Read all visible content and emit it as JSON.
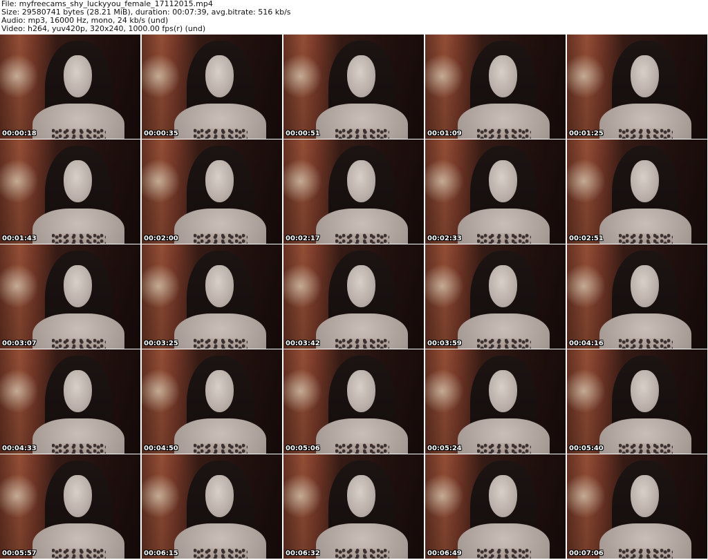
{
  "header": {
    "file": "File: myfreecams_shy_luckyyou_female_17112015.mp4",
    "size": "Size: 29580741 bytes (28.21 MiB), duration: 00:07:39, avg.bitrate: 516 kb/s",
    "audio": "Audio: mp3, 16000 Hz, mono, 24 kb/s (und)",
    "video": "Video: h264, yuv420p, 320x240, 1000.00 fps(r) (und)"
  },
  "thumbnails": [
    {
      "timestamp": "00:00:18"
    },
    {
      "timestamp": "00:00:35"
    },
    {
      "timestamp": "00:00:51"
    },
    {
      "timestamp": "00:01:09"
    },
    {
      "timestamp": "00:01:25"
    },
    {
      "timestamp": "00:01:43"
    },
    {
      "timestamp": "00:02:00"
    },
    {
      "timestamp": "00:02:17"
    },
    {
      "timestamp": "00:02:33"
    },
    {
      "timestamp": "00:02:51"
    },
    {
      "timestamp": "00:03:07"
    },
    {
      "timestamp": "00:03:25"
    },
    {
      "timestamp": "00:03:42"
    },
    {
      "timestamp": "00:03:59"
    },
    {
      "timestamp": "00:04:16"
    },
    {
      "timestamp": "00:04:33"
    },
    {
      "timestamp": "00:04:50"
    },
    {
      "timestamp": "00:05:06"
    },
    {
      "timestamp": "00:05:24"
    },
    {
      "timestamp": "00:05:40"
    },
    {
      "timestamp": "00:05:57"
    },
    {
      "timestamp": "00:06:15"
    },
    {
      "timestamp": "00:06:32"
    },
    {
      "timestamp": "00:06:49"
    },
    {
      "timestamp": "00:07:06"
    }
  ]
}
